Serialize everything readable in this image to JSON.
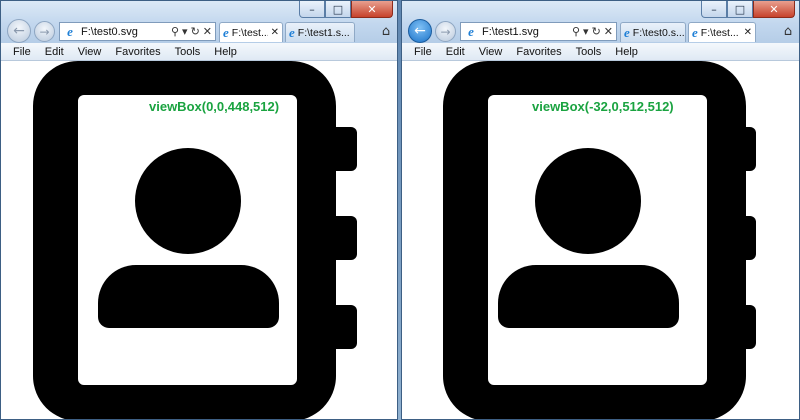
{
  "colors": {
    "accent": "#1aa340",
    "icon": "#000000"
  },
  "windows": [
    {
      "address": "F:\\test0.svg",
      "back_active": false,
      "tabs": [
        {
          "label": "F:\\test...",
          "active": true
        },
        {
          "label": "F:\\test1.s...",
          "active": false
        }
      ],
      "menu": [
        "File",
        "Edit",
        "View",
        "Favorites",
        "Tools",
        "Help"
      ],
      "svg_label": "viewBox(0,0,448,512)",
      "icon": "address-book-icon"
    },
    {
      "address": "F:\\test1.svg",
      "back_active": true,
      "tabs": [
        {
          "label": "F:\\test0.s...",
          "active": false
        },
        {
          "label": "F:\\test...",
          "active": true
        }
      ],
      "menu": [
        "File",
        "Edit",
        "View",
        "Favorites",
        "Tools",
        "Help"
      ],
      "svg_label": "viewBox(-32,0,512,512)",
      "icon": "address-book-icon"
    }
  ]
}
